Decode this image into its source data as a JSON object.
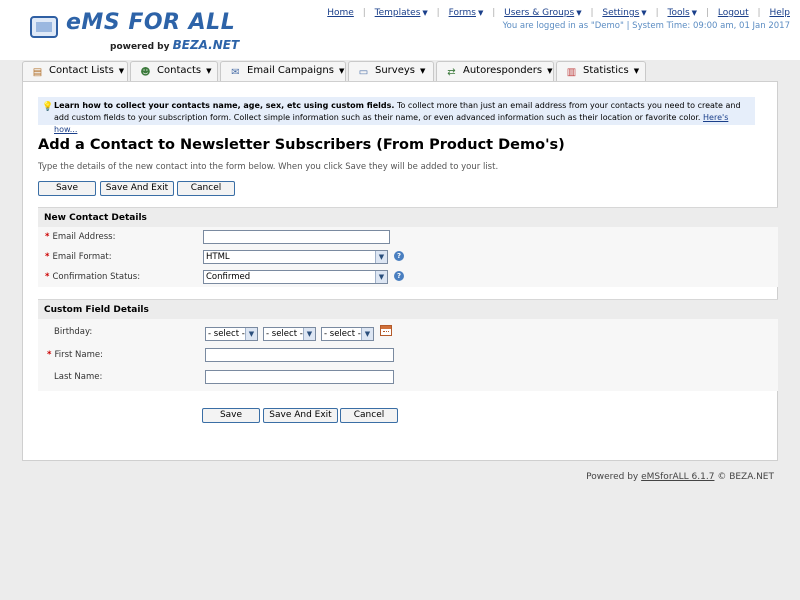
{
  "brand": {
    "name": "eMS FOR ALL",
    "powered_prefix": "powered by",
    "powered_brand": "BEZA.NET"
  },
  "topnav": {
    "items": [
      {
        "label": "Home"
      },
      {
        "label": "Templates"
      },
      {
        "label": "Forms"
      },
      {
        "label": "Users & Groups"
      },
      {
        "label": "Settings"
      },
      {
        "label": "Tools"
      },
      {
        "label": "Logout"
      },
      {
        "label": "Help"
      }
    ],
    "status": "You are logged in as \"Demo\" | System Time: 09:00 am, 01 Jan 2017"
  },
  "tabs": [
    {
      "label": "Contact Lists",
      "icon": "contact-lists-icon"
    },
    {
      "label": "Contacts",
      "icon": "contacts-icon"
    },
    {
      "label": "Email Campaigns",
      "icon": "email-icon"
    },
    {
      "label": "Surveys",
      "icon": "surveys-icon"
    },
    {
      "label": "Autoresponders",
      "icon": "autoresponders-icon"
    },
    {
      "label": "Statistics",
      "icon": "statistics-icon"
    }
  ],
  "tip": {
    "bold": "Learn how to collect your contacts name, age, sex, etc using custom fields.",
    "text": " To collect more than just an email address from your contacts you need to create and add custom fields to your subscription form. Collect simple information such as their name, or even advanced information such as their location or favorite color. ",
    "link": "Here's how..."
  },
  "page": {
    "title": "Add a Contact to Newsletter Subscribers (From Product Demo's)",
    "intro": "Type the details of the new contact into the form below. When you click Save they will be added to your list."
  },
  "buttons": {
    "save": "Save",
    "save_exit_top": "Save And Exit",
    "save_exit_bottom": "Save And Exit",
    "cancel": "Cancel"
  },
  "contact_section": {
    "title": "New Contact Details",
    "email_label": "Email Address:",
    "email_value": "",
    "format_label": "Email Format:",
    "format_value": "HTML",
    "status_label": "Confirmation Status:",
    "status_value": "Confirmed"
  },
  "custom_section": {
    "title": "Custom Field Details",
    "birthday_label": "Birthday:",
    "select_placeholder": "- select -",
    "first_name_label": "First Name:",
    "first_name_value": "",
    "last_name_label": "Last Name:",
    "last_name_value": ""
  },
  "footer": {
    "prefix": "Powered by ",
    "link": "eMSforALL 6.1.7",
    "suffix": " © BEZA.NET"
  },
  "colors": {
    "accent": "#2d63a8",
    "link": "#1a3f8a",
    "status": "#5b8cc2",
    "required": "#cc0000"
  }
}
